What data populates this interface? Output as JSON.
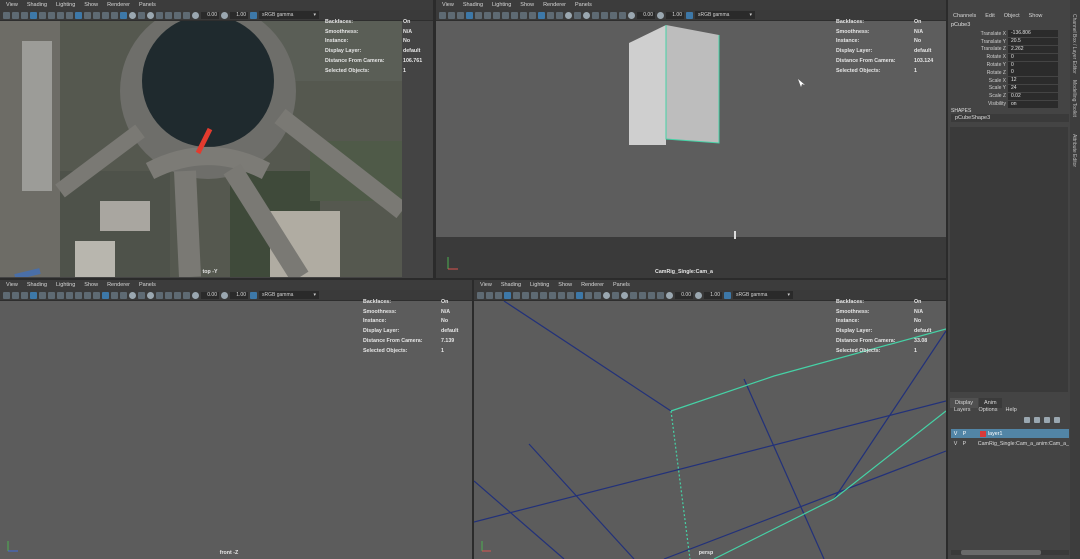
{
  "pane_menu": [
    "View",
    "Shading",
    "Lighting",
    "Show",
    "Renderer",
    "Panels"
  ],
  "toolbar": {
    "field_a": "0.00",
    "field_b": "1.00",
    "color_space": "sRGB gamma"
  },
  "hud_keys": [
    "Backfaces:",
    "Smoothness:",
    "Instance:",
    "Display Layer:",
    "Distance From Camera:",
    "Selected Objects:"
  ],
  "panes": {
    "top": {
      "camera": "top -Y",
      "hud_values": [
        "On",
        "N/A",
        "No",
        "default",
        "106.761",
        "1"
      ]
    },
    "camrig": {
      "camera": "CamRig_Single:Cam_a",
      "hud_values": [
        "On",
        "N/A",
        "No",
        "default",
        "103.124",
        "1"
      ]
    },
    "front": {
      "camera": "front -Z",
      "hud_values": [
        "On",
        "N/A",
        "No",
        "default",
        "7.139",
        "1"
      ]
    },
    "persp": {
      "camera": "persp",
      "hud_values": [
        "On",
        "N/A",
        "No",
        "default",
        "33.08",
        "1"
      ]
    }
  },
  "side": {
    "menu": [
      "Channels",
      "Edit",
      "Object",
      "Show"
    ],
    "object_name": "pCube3",
    "attributes": [
      {
        "label": "Translate X",
        "value": "-136.806"
      },
      {
        "label": "Translate Y",
        "value": "20.5"
      },
      {
        "label": "Translate Z",
        "value": "2.262"
      },
      {
        "label": "Rotate X",
        "value": "0"
      },
      {
        "label": "Rotate Y",
        "value": "0"
      },
      {
        "label": "Rotate Z",
        "value": "0"
      },
      {
        "label": "Scale X",
        "value": "12"
      },
      {
        "label": "Scale Y",
        "value": "24"
      },
      {
        "label": "Scale Z",
        "value": "0.02"
      },
      {
        "label": "Visibility",
        "value": "on"
      }
    ],
    "shapes_header": "SHAPES",
    "shape_name": "pCubeShape3",
    "vertical_tabs": [
      "Channel Box / Layer Editor",
      "Modelling Toolkit",
      "Attribute Editor"
    ],
    "layer_tabs": [
      "Display",
      "Anim"
    ],
    "layer_menu": [
      "Layers",
      "Options",
      "Help"
    ],
    "layers": [
      {
        "v": "V",
        "p": "P",
        "name": "layer1",
        "color": "#d93a3a"
      },
      {
        "v": "V",
        "p": "P",
        "name": "CamRig_Single:Cam_a_anim:Cam_a_a",
        "color": ""
      }
    ]
  }
}
